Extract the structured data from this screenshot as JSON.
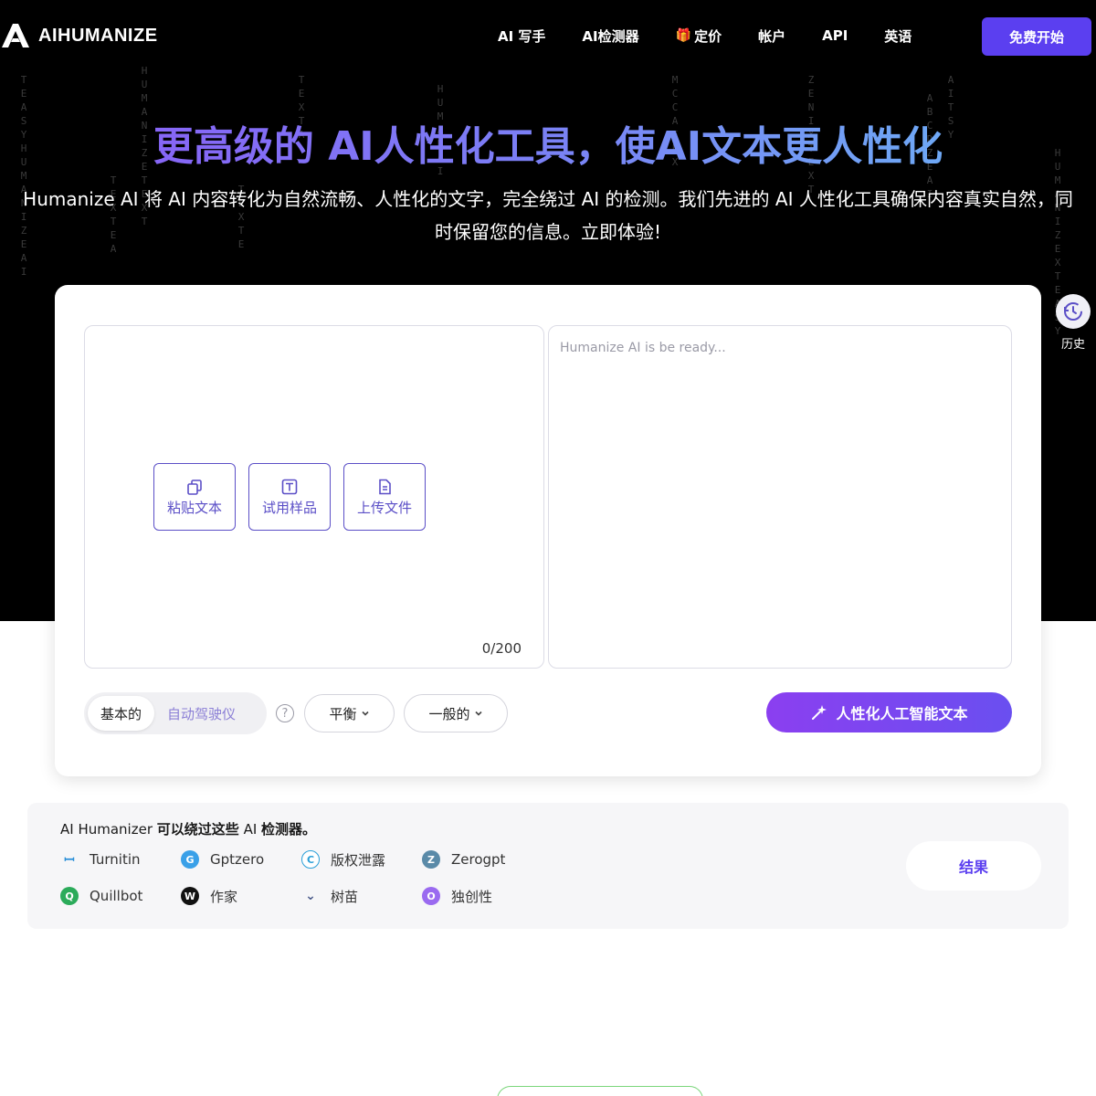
{
  "nav": {
    "logo_text": "AIHUMANIZE",
    "links": [
      "AI 写手",
      "AI检测器",
      "定价",
      "帐户",
      "API",
      "英语"
    ],
    "pricing_icon": "gift-icon",
    "start_label": "免费开始"
  },
  "hero": {
    "title": "更高级的 AI人性化工具，使AI文本更人性化",
    "subtitle": "Humanize AI 将 AI 内容转化为自然流畅、人性化的文字，完全绕过 AI 的检测。我们先进的 AI 人性化工具确保内容真实自然，同时保留您的信息。立即体验!"
  },
  "history": {
    "label": "历史"
  },
  "editor": {
    "paste_label": "粘贴文本",
    "sample_label": "试用样品",
    "upload_label": "上传文件",
    "counter": "0/200",
    "output_placeholder": "Humanize AI is be ready..."
  },
  "controls": {
    "mode_basic": "基本的",
    "mode_auto": "自动驾驶仪",
    "help": "?",
    "dropdown_balance": "平衡",
    "dropdown_general": "一般的",
    "humanize_label": "人性化人工智能文本"
  },
  "detectors": {
    "title_bold_1": "AI Humanizer",
    "title_bold_2": "可以绕过这些",
    "title_rest_1": "AI",
    "title_bold_3": "检测器。",
    "items": [
      {
        "label": "Turnitin",
        "color": "#2a8fd8"
      },
      {
        "label": "Gptzero",
        "color": "#3aa0e8"
      },
      {
        "label": "版权泄露",
        "color": "#2a9fd8"
      },
      {
        "label": "Zerogpt",
        "color": "#5a8aa8"
      },
      {
        "label": "Quillbot",
        "color": "#2bab5a"
      },
      {
        "label": "作家",
        "color": "#111111"
      },
      {
        "label": "树苗",
        "color": "#4a5a8a"
      },
      {
        "label": "独创性",
        "color": "#9a6af0"
      }
    ],
    "result_label": "结果"
  },
  "colors": {
    "accent": "#5b3ff0",
    "hero_bg": "#000000"
  }
}
